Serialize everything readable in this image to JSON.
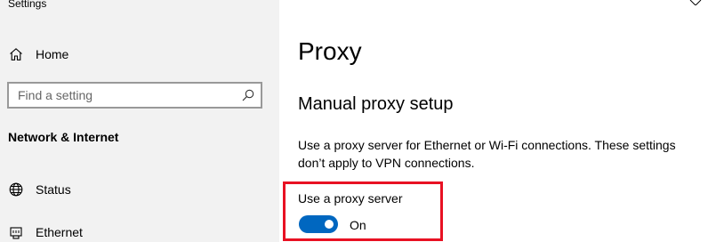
{
  "window": {
    "title": "Settings"
  },
  "sidebar": {
    "home_label": "Home",
    "search": {
      "placeholder": "Find a setting",
      "value": ""
    },
    "section_heading": "Network & Internet",
    "items": [
      {
        "label": "Status",
        "icon": "globe-icon"
      },
      {
        "label": "Ethernet",
        "icon": "ethernet-icon"
      }
    ]
  },
  "main": {
    "page_title": "Proxy",
    "section_title": "Manual proxy setup",
    "description": "Use a proxy server for Ethernet or Wi-Fi connections. These settings don’t apply to VPN connections.",
    "proxy_toggle": {
      "label": "Use a proxy server",
      "state_text": "On",
      "on": true
    }
  },
  "colors": {
    "accent": "#0067c0",
    "highlight": "#e81123",
    "sidebar_bg": "#f2f2f2"
  }
}
